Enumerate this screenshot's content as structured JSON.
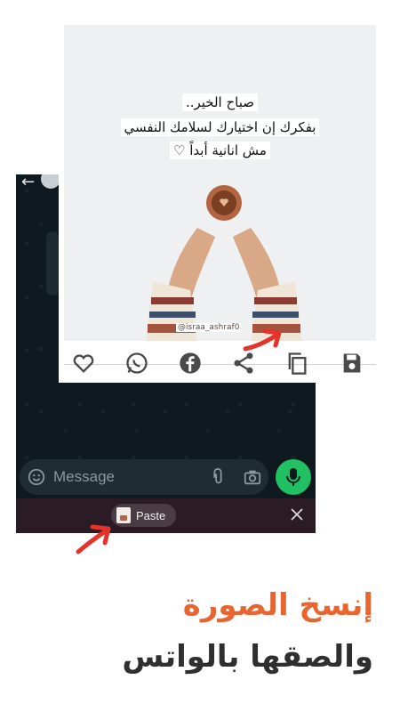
{
  "image_post": {
    "quote_line_1": "صباح الخير..",
    "quote_line_2": "بفكرك إن اختيارك لسلامك النفسي",
    "quote_line_3": "مش انانية أبداً ♡",
    "watermark": "@israa_ashraf0"
  },
  "share_actions": [
    "heart-icon",
    "whatsapp-icon",
    "facebook-icon",
    "share-icon",
    "copy-icon",
    "save-icon"
  ],
  "whatsapp": {
    "message_placeholder": "Message",
    "paste_label": "Paste"
  },
  "caption": {
    "line_1": "إنسخ الصورة",
    "line_2": "والصقها بالواتس"
  },
  "colors": {
    "accent_orange": "#e9652f",
    "arrow_red": "#e3332a",
    "whatsapp_green": "#21c063",
    "dark_text": "#2f2f2f"
  }
}
